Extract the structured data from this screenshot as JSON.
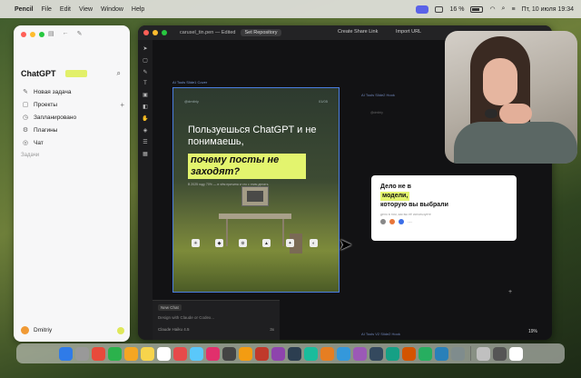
{
  "menubar": {
    "app_name": "Pencil",
    "menus": [
      "File",
      "Edit",
      "View",
      "Window",
      "Help"
    ],
    "datetime": "Пт, 10 июля 19:34",
    "battery": "16 %"
  },
  "chatgpt": {
    "title": "ChatGPT",
    "nav": [
      {
        "label": "Новая задача",
        "icon": "✎"
      },
      {
        "label": "Проекты",
        "icon": "▢",
        "plus": "+"
      },
      {
        "label": "Запланировано",
        "icon": "◷"
      },
      {
        "label": "Плагины",
        "icon": "⚙"
      },
      {
        "label": "Чат",
        "icon": "◎"
      }
    ],
    "section_label": "Задачи",
    "user_name": "Dmitriy"
  },
  "pencil": {
    "doc_title": "carusel_tin.pen — Edited",
    "set_button": "Set Repository",
    "share_label": "Create Share Link",
    "import_label": "Import URL",
    "frame1_label": "AI Tools Slide1 Cover",
    "frame2_label": "AI Tools Slide2 Hook",
    "frame3_label": "AI Tools V2 Slide2 Hook",
    "slide": {
      "header_left": "@dmitriy",
      "header_right": "01/05",
      "heading": "Пользуешься ChatGPT и не понимаешь,",
      "highlight": "почему посты не заходят?",
      "sub": "В 2025 году 70% — в чём причина и что с этим делать"
    },
    "card": {
      "line1": "Дело не в",
      "line2": "модели,",
      "line3": "которую вы выбрали",
      "small": "дело в том, как вы её используете"
    },
    "chat": {
      "tag": "New Chat",
      "placeholder": "Design with Claude or Codex...",
      "model": "Claude Haiku 4.5",
      "count": "3x"
    },
    "zoom": "19%"
  },
  "dock_apps": [
    "#2f7be8",
    "#999",
    "#e84a3b",
    "#2bb24c",
    "#f5a623",
    "#f7d44c",
    "#fff",
    "#e64a4a",
    "#5ac8fa",
    "#e1306c",
    "#444",
    "#f39c12",
    "#c0392b",
    "#8e44ad",
    "#2c3e50",
    "#1abc9c",
    "#e67e22",
    "#3498db",
    "#9b59b6",
    "#34495e",
    "#16a085",
    "#d35400",
    "#27ae60",
    "#2980b9",
    "#7f8c8d",
    "#c0c0c0",
    "#555",
    "#fff"
  ]
}
